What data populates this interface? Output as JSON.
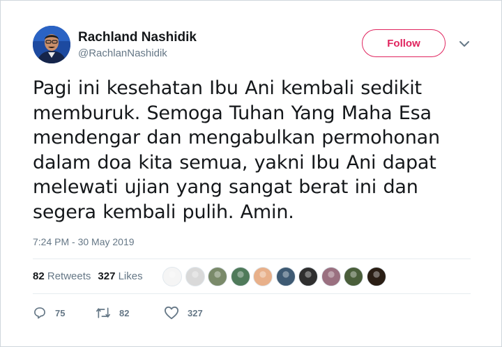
{
  "user": {
    "name": "Rachland Nashidik",
    "handle": "@RachlanNashidik",
    "follow_label": "Follow"
  },
  "tweet": {
    "lines": [
      "Pagi ini kesehatan Ibu Ani kembali sedikit",
      "memburuk. Semoga Tuhan Yang Maha Esa",
      "mendengar dan mengabulkan permohonan",
      "dalam doa kita semua, yakni Ibu Ani dapat",
      "melewati ujian yang sangat berat ini dan",
      "segera kembali pulih. Amin."
    ],
    "timestamp": "7:24 PM - 30 May 2019"
  },
  "stats": {
    "retweets_count": "82",
    "retweets_label": "Retweets",
    "likes_count": "327",
    "likes_label": "Likes"
  },
  "liker_avatar_colors": [
    "#f5f5f5",
    "#d9d9d9",
    "#7a8a6a",
    "#4f7a5a",
    "#e8b08a",
    "#3e5a73",
    "#2f2f2f",
    "#9a7080",
    "#4a5e3a",
    "#2a1e14"
  ],
  "actions": {
    "replies": "75",
    "retweets": "82",
    "likes": "327"
  },
  "icons": {
    "reply": "reply-icon",
    "retweet": "retweet-icon",
    "like": "heart-icon",
    "menu": "chevron-down-icon"
  },
  "colors": {
    "accent": "#e0245e",
    "secondary_text": "#657786",
    "primary_text": "#14171a"
  }
}
